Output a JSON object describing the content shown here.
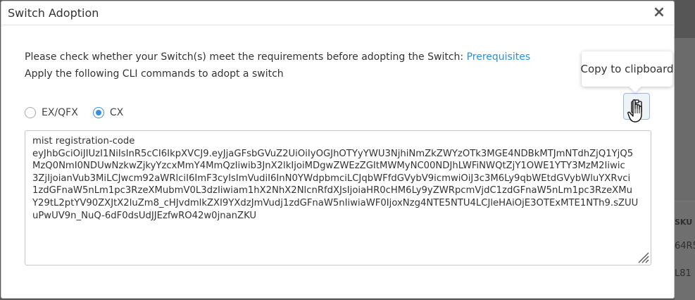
{
  "modal": {
    "title": "Switch Adoption",
    "close_symbol": "×",
    "requirements_text": "Please check whether your Switch(s) meet the requirements before adopting the Switch: ",
    "prerequisites_link": "Prerequisites",
    "cli_instructions": "Apply the following CLI commands to adopt a switch",
    "radio_options": [
      {
        "label": "EX/QFX",
        "checked": false
      },
      {
        "label": "CX",
        "checked": true
      }
    ],
    "tooltip": "Copy to clipboard",
    "copy_icon": "clipboard-icon",
    "code_lines": [
      "mist registration-code",
      "eyJhbGciOiJIUzI1NiIsInR5cCI6IkpXVCJ9.eyJjaGFsbGVuZ2UiOiIyOGJhOTYyYWU3NjhiNmZkZWYzOTk3MGE4NDBkMTJmNTdhZjQ1YjQ5",
      "MzQ0NmI0NDUwNzkwZjkyYzcxMmY4MmQzIiwib3JnX2lkIjoiMDgwZWEzZGItMWMyNC00NDJhLWFiNWQtZjY1OWE1YTY3MzM2Iiwic",
      "3ZjIjoianVub3MiLCJwcm92aWRlciI6ImF3cyIsImVudiI6InN0YWdpbmciLCJqbWFfdGVybV9icmwiOiJ3c3M6Ly9qbWEtdGVybWluYXRvci",
      "1zdGFnaW5nLm1pc3RzeXMubmV0L3dzIiwiam1hX2NhX2NlcnRfdXJsIjoiaHR0cHM6Ly9yZWRpcmVjdC1zdGFnaW5nLm1pc3RzeXMu",
      "Y29tL2ptYV90ZXJtX2luZm8_cHJvdmlkZXI9YXdzJmVudj1zdGFnaW5nIiwiaWF0IjoxNzg4NTE5NTU4LCJleHAiOjE3OTExMTE1NTh9.sZUU",
      "uPwUV9n_NuQ-6dF0dsUdJJEzfwRO42w0jnanZKU"
    ]
  },
  "background": {
    "column_header": "SKU",
    "row1": "64R5",
    "row2": "L81"
  },
  "colors": {
    "link": "#2d8fd5",
    "radio_selected": "#3b8fd9"
  }
}
